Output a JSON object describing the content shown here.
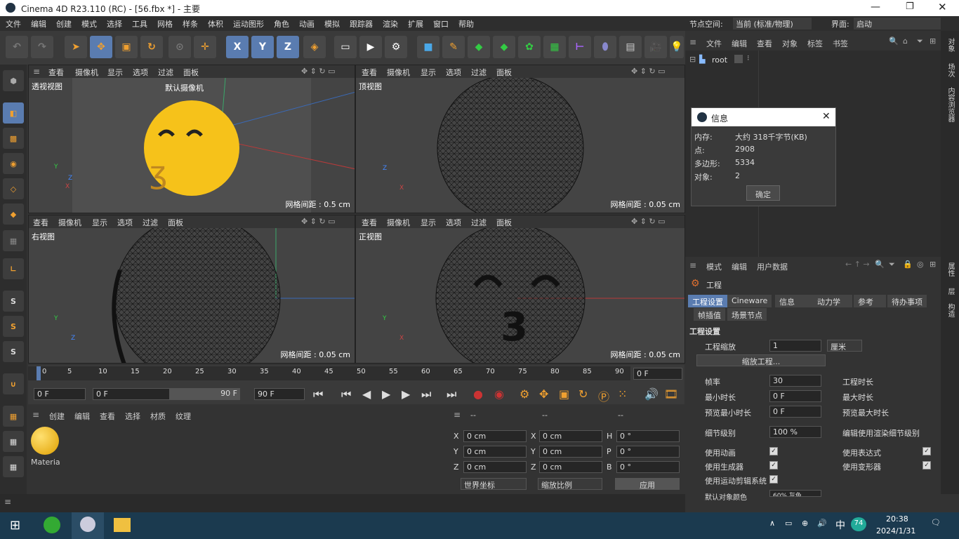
{
  "titlebar": {
    "title": "Cinema 4D R23.110 (RC) - [56.fbx *] - 主要"
  },
  "menu": [
    "文件",
    "编辑",
    "创建",
    "模式",
    "选择",
    "工具",
    "网格",
    "样条",
    "体积",
    "运动图形",
    "角色",
    "动画",
    "模拟",
    "跟踪器",
    "渲染",
    "扩展",
    "窗口",
    "帮助"
  ],
  "menu_right": {
    "node_space_label": "节点空间:",
    "node_space_value": "当前 (标准/物理)",
    "layout_label": "界面:",
    "layout_value": "启动"
  },
  "toolbar": {
    "x": "X",
    "y": "Y",
    "z": "Z"
  },
  "viewports": [
    {
      "menu": [
        "查看",
        "摄像机",
        "显示",
        "选项",
        "过滤",
        "面板"
      ],
      "label": "透视视图",
      "camera": "默认摄像机",
      "grid": "网格间距 : 0.5 cm"
    },
    {
      "menu": [
        "查看",
        "摄像机",
        "显示",
        "选项",
        "过滤",
        "面板"
      ],
      "label": "顶视图",
      "grid": "网格间距 : 0.05 cm"
    },
    {
      "menu": [
        "查看",
        "摄像机",
        "显示",
        "选项",
        "过滤",
        "面板"
      ],
      "label": "右视图",
      "grid": "网格间距 : 0.05 cm"
    },
    {
      "menu": [
        "查看",
        "摄像机",
        "显示",
        "选项",
        "过滤",
        "面板"
      ],
      "label": "正视图",
      "grid": "网格间距 : 0.05 cm"
    }
  ],
  "timeline": {
    "ticks": [
      "0",
      "5",
      "10",
      "15",
      "20",
      "25",
      "30",
      "35",
      "40",
      "45",
      "50",
      "55",
      "60",
      "65",
      "70",
      "75",
      "80",
      "85",
      "90"
    ],
    "end": "0 F",
    "current": "0 F",
    "range_start": "0 F",
    "range_end": "90 F",
    "max": "90 F"
  },
  "materials": {
    "menu": [
      "创建",
      "编辑",
      "查看",
      "选择",
      "材质",
      "纹理"
    ],
    "item": "Materia"
  },
  "coords": {
    "header": [
      "--",
      "--",
      "--"
    ],
    "rows": [
      {
        "a": "X",
        "av": "0 cm",
        "b": "X",
        "bv": "0 cm",
        "c": "H",
        "cv": "0 °"
      },
      {
        "a": "Y",
        "av": "0 cm",
        "b": "Y",
        "bv": "0 cm",
        "c": "P",
        "cv": "0 °"
      },
      {
        "a": "Z",
        "av": "0 cm",
        "b": "Z",
        "bv": "0 cm",
        "c": "B",
        "cv": "0 °"
      }
    ],
    "world": "世界坐标",
    "scale": "缩放比例",
    "apply": "应用"
  },
  "objects": {
    "menu": [
      "文件",
      "编辑",
      "查看",
      "对象",
      "标签",
      "书签"
    ],
    "root": "root"
  },
  "side_tabs": [
    "对象",
    "场次",
    "内容浏览器",
    "属性",
    "层",
    "构造"
  ],
  "dialog": {
    "title": "信息",
    "rows": [
      {
        "k": "内存:",
        "v": "大约 318千字节(KB)"
      },
      {
        "k": "点:",
        "v": "2908"
      },
      {
        "k": "多边形:",
        "v": "5334"
      },
      {
        "k": "对象:",
        "v": "2"
      }
    ],
    "ok": "确定"
  },
  "attr": {
    "menu": [
      "模式",
      "编辑",
      "用户数据"
    ],
    "object": "工程",
    "tabs": [
      "工程设置",
      "Cineware",
      "信息",
      "动力学",
      "参考",
      "待办事项"
    ],
    "tabs2": [
      "帧插值",
      "场景节点"
    ],
    "section": "工程设置",
    "scale_label": "工程缩放",
    "scale_value": "1",
    "scale_unit": "厘米",
    "scale_btn": "缩放工程...",
    "fps_label": "帧率",
    "fps_value": "30",
    "duration_label": "工程时长",
    "min_label": "最小时长",
    "min_value": "0 F",
    "max_label": "最大时长",
    "pmin_label": "预览最小时长",
    "pmin_value": "0 F",
    "pmax_label": "预览最大时长",
    "lod_label": "细节级别",
    "lod_value": "100 %",
    "lod_edit": "编辑使用渲染细节级别",
    "anim": "使用动画",
    "expr": "使用表达式",
    "gen": "使用生成器",
    "deform": "使用变形器",
    "motion": "使用运动剪辑系统",
    "color_label": "默认对象颜色",
    "color_value": "60% 灰色"
  },
  "taskbar": {
    "time": "20:38",
    "date": "2024/1/31",
    "ime": "中",
    "badge": "74"
  },
  "colors": {
    "accent": "#5a7cb0",
    "emoji": "#f6c21a"
  }
}
